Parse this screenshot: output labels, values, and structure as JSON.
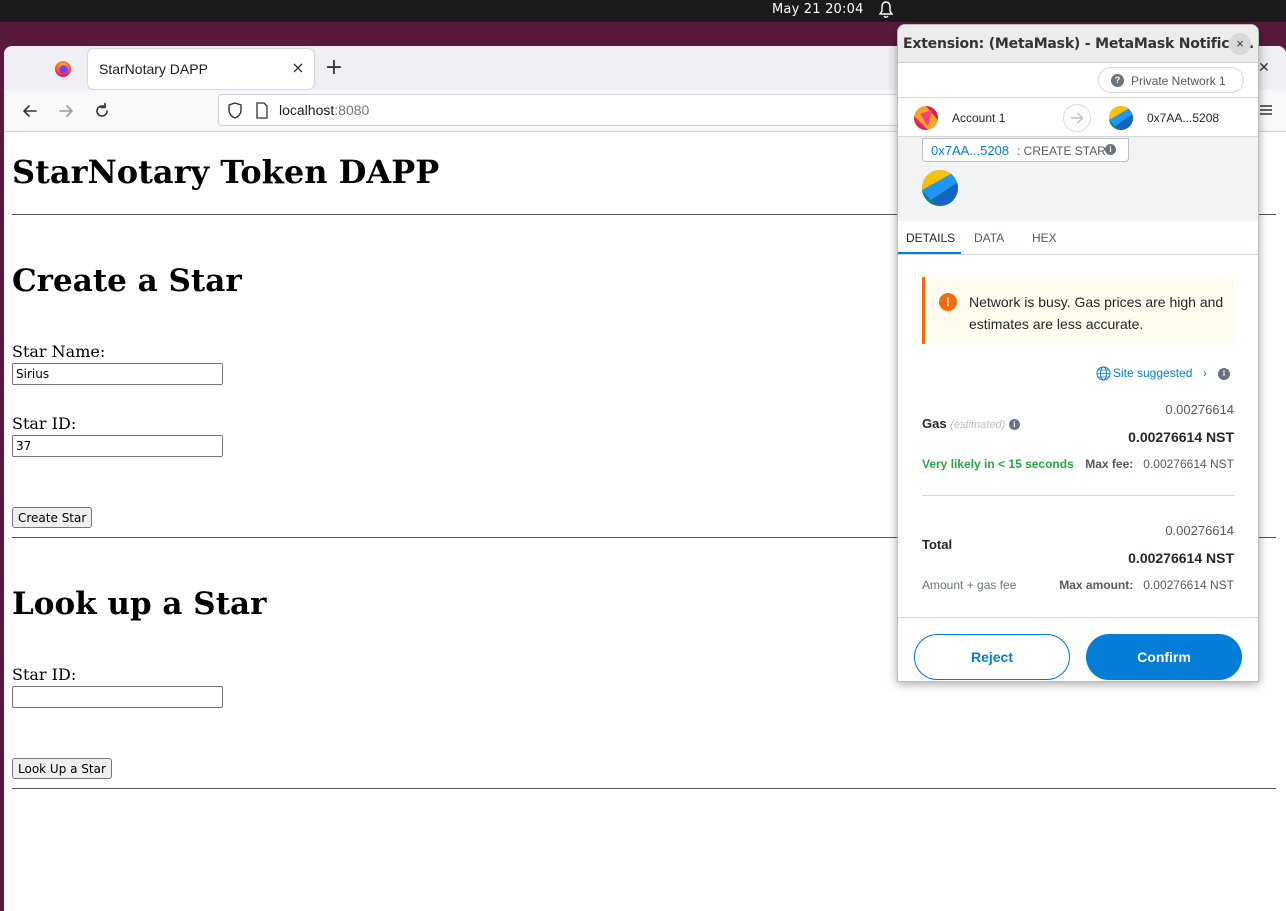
{
  "system": {
    "clock": "May 21  20:04"
  },
  "browser": {
    "tab_title": "StarNotary DAPP",
    "tab_close": "×",
    "new_tab": "+",
    "url_host": "localhost",
    "url_port": ":8080"
  },
  "page": {
    "title": "StarNotary Token DAPP",
    "create": {
      "heading": "Create a Star",
      "name_label": "Star Name:",
      "name_value": "Sirius",
      "id_label": "Star ID:",
      "id_value": "37",
      "button": "Create Star"
    },
    "lookup": {
      "heading": "Look up a Star",
      "id_label": "Star ID:",
      "id_value": "",
      "button": "Look Up a Star"
    }
  },
  "metamask": {
    "window_title": "Extension: (MetaMask) - MetaMask Notifica...",
    "close": "×",
    "network": "Private Network 1",
    "from_account": "Account 1",
    "to_account": "0x7AA...5208",
    "origin_address": "0x7AA...5208",
    "method": ": CREATE STAR",
    "tabs": [
      "DETAILS",
      "DATA",
      "HEX"
    ],
    "warning": "Network is busy. Gas prices are high and estimates are less accurate.",
    "site_suggested": "Site suggested",
    "gas_label": "Gas",
    "gas_estimated": "(estimated)",
    "gas_value_small": "0.00276614",
    "gas_value_big": "0.00276614 NST",
    "likely": "Very likely in < 15 seconds",
    "max_fee_label": "Max fee:",
    "max_fee_value": "0.00276614 NST",
    "total_label": "Total",
    "total_value_small": "0.00276614",
    "total_value_big": "0.00276614 NST",
    "amount_gas_fee": "Amount + gas fee",
    "max_amount_label": "Max amount:",
    "max_amount_value": "0.00276614 NST",
    "reject": "Reject",
    "confirm": "Confirm",
    "colors": {
      "primary": "#037dd6",
      "warning": "#f66a0a",
      "success": "#28a745"
    }
  }
}
